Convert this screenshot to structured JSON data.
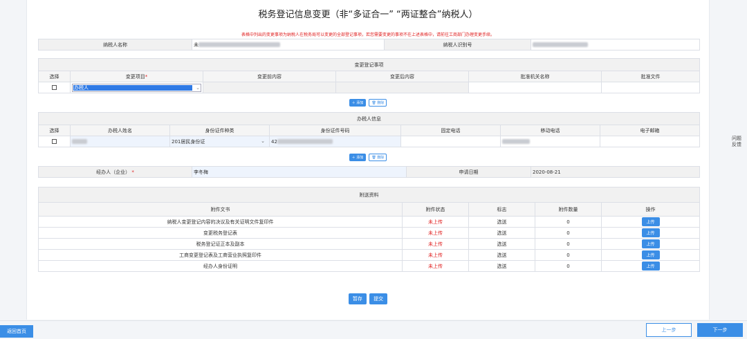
{
  "page": {
    "title": "税务登记信息变更（非“多证合一” “两证整合”纳税人）",
    "notice": "表格中列出的变更事项为纳税人在税务局可以变更的全部登记事项，若您需要变更的事项不在上述表格中，请前往工商部门办理变更手续。"
  },
  "taxpayer": {
    "name_label": "纳税人名称",
    "name_value": "未",
    "id_label": "纳税人识别号"
  },
  "changes": {
    "section_title": "变更登记事项",
    "headers": {
      "select": "选择",
      "item": "变更项目",
      "before": "变更前内容",
      "after": "变更后内容",
      "authority": "批准机关名称",
      "document": "批准文件"
    },
    "row": {
      "item_value": "办税人"
    },
    "add_label": "添加",
    "delete_label": "删除"
  },
  "agent": {
    "section_title": "办税人信息",
    "headers": {
      "select": "选择",
      "name": "办税人姓名",
      "id_type": "身份证件种类",
      "id_number": "身份证件号码",
      "phone": "固定电话",
      "mobile": "移动电话",
      "email": "电子邮箱"
    },
    "row": {
      "id_type_value": "201居民身份证",
      "id_number_prefix": "42"
    },
    "add_label": "添加",
    "delete_label": "删除"
  },
  "handler": {
    "label": "经办人（企业）",
    "value": "李冬梅",
    "date_label": "申请日期",
    "date_value": "2020-08-21"
  },
  "attachments": {
    "section_title": "附送资料",
    "headers": {
      "file": "附件文书",
      "status": "附件状态",
      "flag": "标志",
      "count": "附件数量",
      "op": "操作"
    },
    "rows": [
      {
        "file": "纳税人变更登记内容的决议及有关证明文件复印件",
        "status": "未上传",
        "flag": "选送",
        "count": "0",
        "op": "上传"
      },
      {
        "file": "变更税务登记表",
        "status": "未上传",
        "flag": "选送",
        "count": "0",
        "op": "上传"
      },
      {
        "file": "税务登记证正本及副本",
        "status": "未上传",
        "flag": "选送",
        "count": "0",
        "op": "上传"
      },
      {
        "file": "工商变更登记表及工商营业执照复印件",
        "status": "未上传",
        "flag": "选送",
        "count": "0",
        "op": "上传"
      },
      {
        "file": "经办人身份证明",
        "status": "未上传",
        "flag": "选送",
        "count": "0",
        "op": "上传"
      }
    ]
  },
  "actions": {
    "save": "暂存",
    "submit": "提交"
  },
  "footer": {
    "home": "返回首页",
    "prev": "上一步",
    "next": "下一步"
  },
  "side": {
    "feedback": "问题反馈"
  }
}
